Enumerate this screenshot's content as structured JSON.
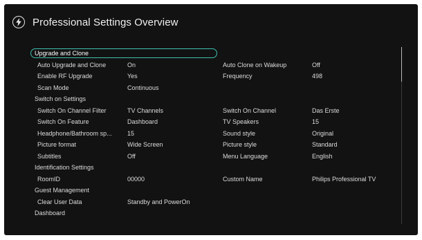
{
  "header": {
    "icon": "lightning-bolt-icon",
    "title": "Professional Settings Overview"
  },
  "rows": [
    {
      "type": "section",
      "label": "Upgrade and Clone",
      "focused": true
    },
    {
      "type": "item",
      "c1": "Auto Upgrade and Clone",
      "c2": "On",
      "c3": "Auto Clone on Wakeup",
      "c4": "Off"
    },
    {
      "type": "item",
      "c1": "Enable RF Upgrade",
      "c2": "Yes",
      "c3": "Frequency",
      "c4": "498"
    },
    {
      "type": "item",
      "c1": "Scan Mode",
      "c2": "Continuous",
      "c3": "",
      "c4": ""
    },
    {
      "type": "section",
      "label": "Switch on Settings"
    },
    {
      "type": "item",
      "c1": "Switch On Channel Filter",
      "c2": "TV Channels",
      "c3": "Switch On Channel",
      "c4": "Das Erste"
    },
    {
      "type": "item",
      "c1": "Switch On Feature",
      "c2": "Dashboard",
      "c3": "TV Speakers",
      "c4": "15"
    },
    {
      "type": "item",
      "c1": "Headphone/Bathroom sp...",
      "c2": "15",
      "c3": "Sound style",
      "c4": "Original"
    },
    {
      "type": "item",
      "c1": "Picture format",
      "c2": "Wide Screen",
      "c3": "Picture style",
      "c4": "Standard"
    },
    {
      "type": "item",
      "c1": "Subtitles",
      "c2": "Off",
      "c3": "Menu Language",
      "c4": "English"
    },
    {
      "type": "section",
      "label": "Identification Settings"
    },
    {
      "type": "item",
      "c1": "RoomID",
      "c2": "00000",
      "c3": "Custom Name",
      "c4": "Philips Professional TV"
    },
    {
      "type": "section",
      "label": "Guest Management"
    },
    {
      "type": "item",
      "c1": "Clear User Data",
      "c2": "Standby and PowerOn",
      "c3": "",
      "c4": ""
    },
    {
      "type": "section",
      "label": "Dashboard"
    }
  ],
  "colors": {
    "background": "#121212",
    "text": "#dcdcdc",
    "focus": "#3fc0b0"
  }
}
